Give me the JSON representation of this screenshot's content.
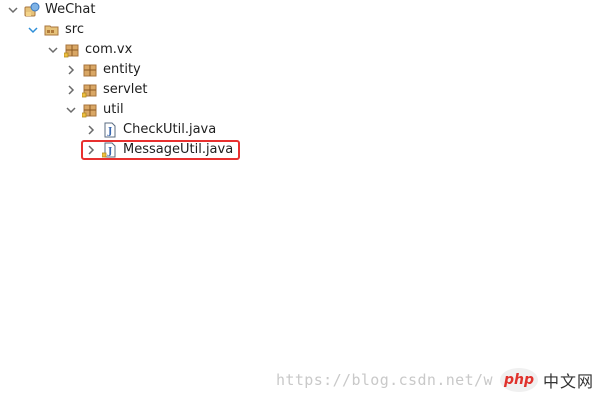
{
  "tree": {
    "project": "WeChat",
    "src": "src",
    "package": "com.vx",
    "children": [
      {
        "label": "entity"
      },
      {
        "label": "servlet"
      },
      {
        "label": "util"
      }
    ],
    "util_files": [
      {
        "label": "CheckUtil.java"
      },
      {
        "label": "MessageUtil.java"
      }
    ]
  },
  "watermark": {
    "url": "https://blog.csdn.net/w",
    "logo_text": "php",
    "site_name": "中文网"
  },
  "colors": {
    "highlight_border": "#e8302f",
    "chevron": "#6b6b6b",
    "src_chevron": "#2f8fd8",
    "package_icon": "#a8763e",
    "watermark_text": "#c9c9c9",
    "logo_red": "#e0322d"
  },
  "icons": {
    "project": "java-project-icon",
    "source_folder": "source-folder-icon",
    "package": "package-icon",
    "java_file": "java-file-icon"
  }
}
